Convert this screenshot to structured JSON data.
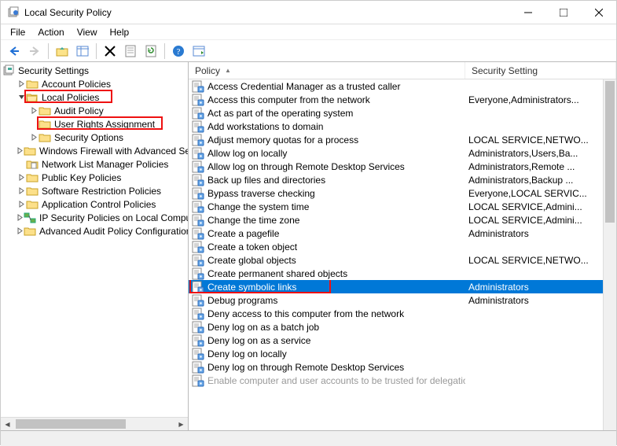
{
  "window": {
    "title": "Local Security Policy"
  },
  "menu": [
    "File",
    "Action",
    "View",
    "Help"
  ],
  "tree": {
    "root": "Security Settings",
    "nodes": [
      {
        "indent": 1,
        "exp": ">",
        "icon": "folder",
        "label": "Account Policies"
      },
      {
        "indent": 1,
        "exp": "v",
        "icon": "folder-open",
        "label": "Local Policies",
        "hl": true
      },
      {
        "indent": 2,
        "exp": ">",
        "icon": "folder",
        "label": "Audit Policy"
      },
      {
        "indent": 2,
        "exp": "",
        "icon": "folder",
        "label": "User Rights Assignment",
        "hl": true
      },
      {
        "indent": 2,
        "exp": ">",
        "icon": "folder",
        "label": "Security Options"
      },
      {
        "indent": 1,
        "exp": ">",
        "icon": "folder",
        "label": "Windows Firewall with Advanced Security"
      },
      {
        "indent": 1,
        "exp": "",
        "icon": "folder-doc",
        "label": "Network List Manager Policies"
      },
      {
        "indent": 1,
        "exp": ">",
        "icon": "folder",
        "label": "Public Key Policies"
      },
      {
        "indent": 1,
        "exp": ">",
        "icon": "folder",
        "label": "Software Restriction Policies"
      },
      {
        "indent": 1,
        "exp": ">",
        "icon": "folder",
        "label": "Application Control Policies"
      },
      {
        "indent": 1,
        "exp": ">",
        "icon": "ipsec",
        "label": "IP Security Policies on Local Computer"
      },
      {
        "indent": 1,
        "exp": ">",
        "icon": "folder",
        "label": "Advanced Audit Policy Configuration"
      }
    ]
  },
  "columns": {
    "policy": "Policy",
    "setting": "Security Setting"
  },
  "rows": [
    {
      "p": "Access Credential Manager as a trusted caller",
      "s": ""
    },
    {
      "p": "Access this computer from the network",
      "s": "Everyone,Administrators..."
    },
    {
      "p": "Act as part of the operating system",
      "s": ""
    },
    {
      "p": "Add workstations to domain",
      "s": ""
    },
    {
      "p": "Adjust memory quotas for a process",
      "s": "LOCAL SERVICE,NETWO..."
    },
    {
      "p": "Allow log on locally",
      "s": "Administrators,Users,Ba..."
    },
    {
      "p": "Allow log on through Remote Desktop Services",
      "s": "Administrators,Remote ..."
    },
    {
      "p": "Back up files and directories",
      "s": "Administrators,Backup ..."
    },
    {
      "p": "Bypass traverse checking",
      "s": "Everyone,LOCAL SERVIC..."
    },
    {
      "p": "Change the system time",
      "s": "LOCAL SERVICE,Admini..."
    },
    {
      "p": "Change the time zone",
      "s": "LOCAL SERVICE,Admini..."
    },
    {
      "p": "Create a pagefile",
      "s": "Administrators"
    },
    {
      "p": "Create a token object",
      "s": ""
    },
    {
      "p": "Create global objects",
      "s": "LOCAL SERVICE,NETWO..."
    },
    {
      "p": "Create permanent shared objects",
      "s": ""
    },
    {
      "p": "Create symbolic links",
      "s": "Administrators",
      "sel": true,
      "hl": true
    },
    {
      "p": "Debug programs",
      "s": "Administrators"
    },
    {
      "p": "Deny access to this computer from the network",
      "s": ""
    },
    {
      "p": "Deny log on as a batch job",
      "s": ""
    },
    {
      "p": "Deny log on as a service",
      "s": ""
    },
    {
      "p": "Deny log on locally",
      "s": ""
    },
    {
      "p": "Deny log on through Remote Desktop Services",
      "s": ""
    },
    {
      "p": "Enable computer and user accounts to be trusted for delegation",
      "s": "",
      "faded": true
    }
  ]
}
